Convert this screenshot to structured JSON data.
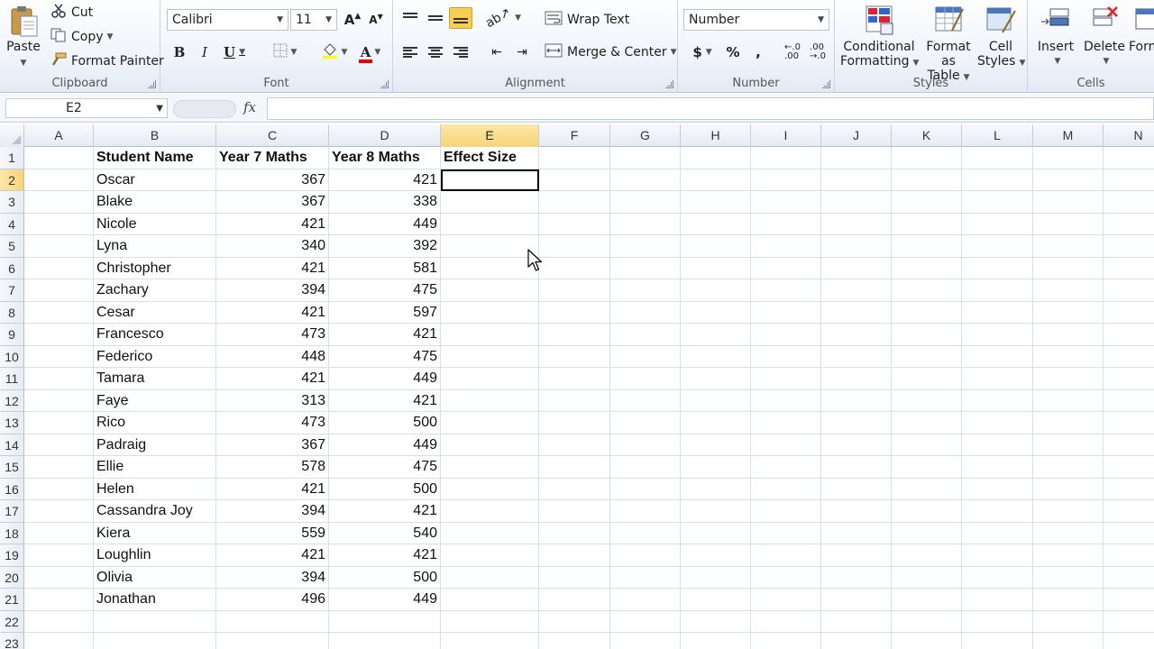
{
  "ribbon": {
    "clipboard": {
      "label": "Clipboard",
      "paste": "Paste",
      "cut": "Cut",
      "copy": "Copy",
      "format_painter": "Format Painter"
    },
    "font": {
      "label": "Font",
      "font_name": "Calibri",
      "font_size": "11",
      "bold": "B",
      "italic": "I",
      "underline": "U",
      "grow": "A",
      "shrink": "A",
      "font_color_letter": "A"
    },
    "alignment": {
      "label": "Alignment",
      "wrap_text": "Wrap Text",
      "merge_center": "Merge & Center"
    },
    "number": {
      "label": "Number",
      "format": "Number",
      "currency": "$",
      "percent": "%",
      "comma": ","
    },
    "styles": {
      "label": "Styles",
      "conditional_formatting_1": "Conditional",
      "conditional_formatting_2": "Formatting",
      "format_as_table_1": "Format",
      "format_as_table_2": "as Table",
      "cell_styles_1": "Cell",
      "cell_styles_2": "Styles"
    },
    "cells": {
      "label": "Cells",
      "insert": "Insert",
      "delete": "Delete",
      "format": "Form"
    }
  },
  "formula_bar": {
    "name_box": "E2",
    "fx": "fx",
    "formula": ""
  },
  "sheet": {
    "columns": [
      "A",
      "B",
      "C",
      "D",
      "E",
      "F",
      "G",
      "H",
      "I",
      "J",
      "K",
      "L",
      "M",
      "N"
    ],
    "row_numbers": [
      "1",
      "2",
      "3",
      "4",
      "5",
      "6",
      "7",
      "8",
      "9",
      "10",
      "11",
      "12",
      "13",
      "14",
      "15",
      "16",
      "17",
      "18",
      "19",
      "20",
      "21",
      "22",
      "23"
    ],
    "headers": {
      "student_name": "Student Name",
      "year7": "Year 7 Maths",
      "year8": "Year 8 Maths",
      "effect_size": "Effect Size"
    },
    "students": [
      {
        "name": "Oscar",
        "y7": "367",
        "y8": "421"
      },
      {
        "name": "Blake",
        "y7": "367",
        "y8": "338"
      },
      {
        "name": "Nicole",
        "y7": "421",
        "y8": "449"
      },
      {
        "name": "Lyna",
        "y7": "340",
        "y8": "392"
      },
      {
        "name": "Christopher",
        "y7": "421",
        "y8": "581"
      },
      {
        "name": "Zachary",
        "y7": "394",
        "y8": "475"
      },
      {
        "name": "Cesar",
        "y7": "421",
        "y8": "597"
      },
      {
        "name": "Francesco",
        "y7": "473",
        "y8": "421"
      },
      {
        "name": "Federico",
        "y7": "448",
        "y8": "475"
      },
      {
        "name": "Tamara",
        "y7": "421",
        "y8": "449"
      },
      {
        "name": "Faye",
        "y7": "313",
        "y8": "421"
      },
      {
        "name": "Rico",
        "y7": "473",
        "y8": "500"
      },
      {
        "name": "Padraig",
        "y7": "367",
        "y8": "449"
      },
      {
        "name": "Ellie",
        "y7": "578",
        "y8": "475"
      },
      {
        "name": "Helen",
        "y7": "421",
        "y8": "500"
      },
      {
        "name": "Cassandra Joy",
        "y7": "394",
        "y8": "421"
      },
      {
        "name": "Kiera",
        "y7": "559",
        "y8": "540"
      },
      {
        "name": "Loughlin",
        "y7": "421",
        "y8": "421"
      },
      {
        "name": "Olivia",
        "y7": "394",
        "y8": "500"
      },
      {
        "name": "Jonathan",
        "y7": "496",
        "y8": "449"
      }
    ],
    "active_cell": "E2",
    "selection_color": "#f6d47a"
  }
}
